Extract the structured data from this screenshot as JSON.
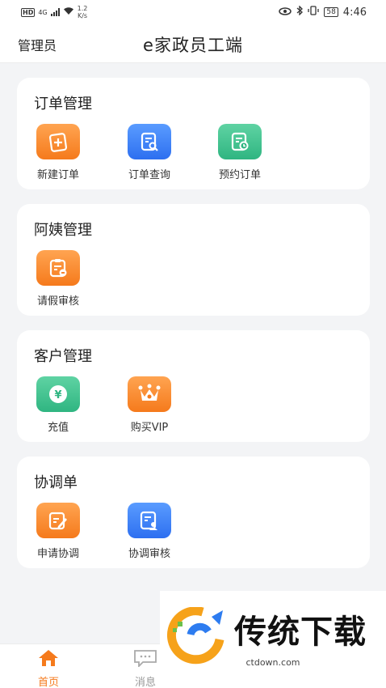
{
  "status_bar": {
    "hd": "HD",
    "net_type": "4G",
    "speed_value": "1.2",
    "speed_unit": "K/s",
    "battery": "58",
    "time": "4:46"
  },
  "header": {
    "role": "管理员",
    "title": "e家政员工端"
  },
  "sections": [
    {
      "title": "订单管理",
      "items": [
        {
          "label": "新建订单",
          "icon": "new-order-icon",
          "color": "#f88a2c"
        },
        {
          "label": "订单查询",
          "icon": "order-search-icon",
          "color": "#3f82f6"
        },
        {
          "label": "预约订单",
          "icon": "appointment-order-icon",
          "color": "#3fbf8a"
        }
      ]
    },
    {
      "title": "阿姨管理",
      "items": [
        {
          "label": "请假审核",
          "icon": "leave-review-icon",
          "color": "#f88a2c"
        }
      ]
    },
    {
      "title": "客户管理",
      "items": [
        {
          "label": "充值",
          "icon": "recharge-icon",
          "color": "#3fbf8a"
        },
        {
          "label": "购买VIP",
          "icon": "vip-crown-icon",
          "color": "#f88a2c"
        }
      ]
    },
    {
      "title": "协调单",
      "items": [
        {
          "label": "申请协调",
          "icon": "apply-coordination-icon",
          "color": "#f88a2c"
        },
        {
          "label": "协调审核",
          "icon": "coordination-review-icon",
          "color": "#3f82f6"
        }
      ]
    }
  ],
  "icon_glyphs": {
    "yuan": "¥"
  },
  "tabbar": {
    "tabs": [
      {
        "label": "首页",
        "icon": "home-icon",
        "active": true
      },
      {
        "label": "消息",
        "icon": "message-icon",
        "active": false
      }
    ],
    "active_color": "#f57a1c",
    "inactive_color": "#999999"
  },
  "watermark": {
    "brand": "传统下载",
    "url": "ctdown.com"
  }
}
